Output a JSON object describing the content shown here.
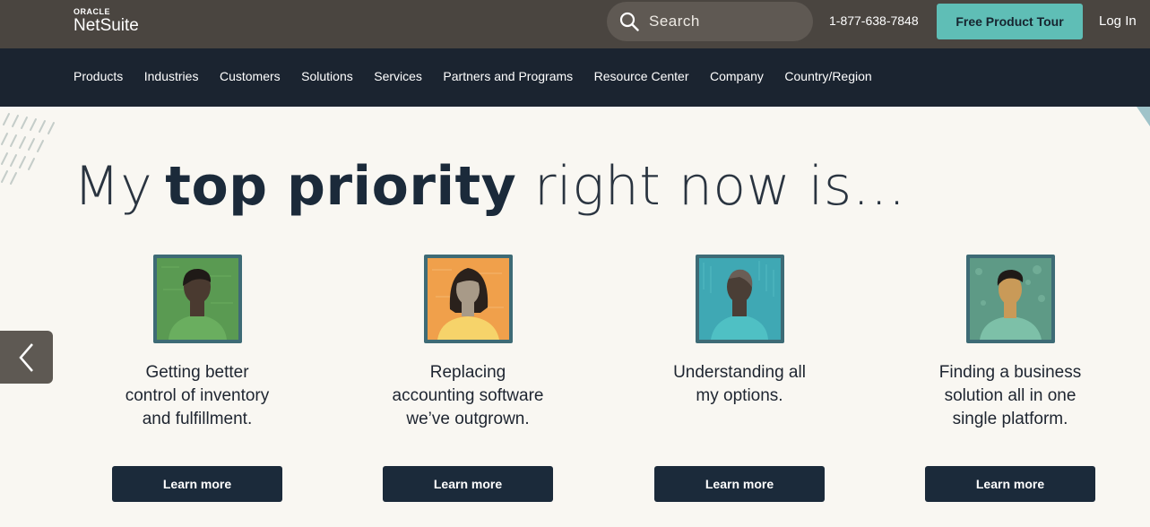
{
  "brand": {
    "oracle": "ORACLE",
    "name": "NetSuite"
  },
  "header": {
    "search_placeholder": "Search",
    "phone": "1-877-638-7848",
    "tour_label": "Free Product Tour",
    "login_label": "Log In"
  },
  "nav": {
    "items": [
      {
        "label": "Products"
      },
      {
        "label": "Industries"
      },
      {
        "label": "Customers"
      },
      {
        "label": "Solutions"
      },
      {
        "label": "Services"
      },
      {
        "label": "Partners and Programs"
      },
      {
        "label": "Resource Center"
      },
      {
        "label": "Company"
      },
      {
        "label": "Country/Region"
      }
    ]
  },
  "hero": {
    "headline_pre": "My",
    "headline_bold": "top priority",
    "headline_post": " right now is…"
  },
  "carousel": {
    "prev_icon": "chevron-left-icon",
    "cards": [
      {
        "line1": "Getting better",
        "line2": "control of inventory",
        "line3": "and fulfillment.",
        "button": "Learn more",
        "bg": "#5a9a52",
        "shirt": "#6aae5f",
        "skin": "#4a3a30",
        "hair": "#1f1a17"
      },
      {
        "line1": "Replacing",
        "line2": "accounting software",
        "line3": "we’ve outgrown.",
        "button": "Learn more",
        "bg": "#f0a04b",
        "shirt": "#f6d36a",
        "skin": "#a89a88",
        "hair": "#2a211c"
      },
      {
        "line1": "Understanding all",
        "line2": "my options.",
        "line3": "",
        "button": "Learn more",
        "bg": "#3fa8b4",
        "shirt": "#4fc0c4",
        "skin": "#4a3e36",
        "hair": "#6a5e56"
      },
      {
        "line1": "Finding a business",
        "line2": "solution all in one",
        "line3": "single platform.",
        "button": "Learn more",
        "bg": "#5e9a86",
        "shirt": "#7dc0a8",
        "skin": "#c99a58",
        "hair": "#1f1a17"
      }
    ]
  },
  "colors": {
    "topbar": "#4a4540",
    "navbar": "#1b2430",
    "accent": "#5fbeb6",
    "button": "#1b2a3a",
    "page_bg": "#f9f7f2"
  }
}
